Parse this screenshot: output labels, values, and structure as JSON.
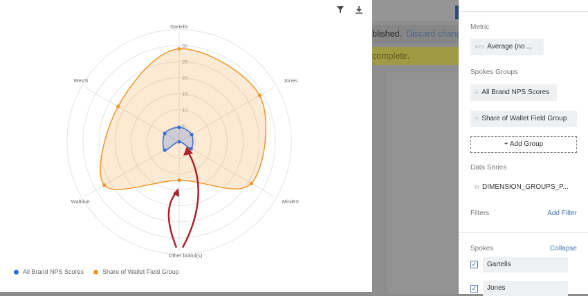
{
  "background": {
    "publish_text": "blished.",
    "discard_link": "Discard changes",
    "warning_text": "complete."
  },
  "toolbar": {
    "filter_icon": "filter-icon",
    "download_icon": "download-icon"
  },
  "chart_data": {
    "type": "radar",
    "axes": [
      "Gartells",
      "Jones",
      "MiniRX",
      "Other brand(s)",
      "Walblue",
      "WeVS"
    ],
    "radial_ticks": [
      "5",
      "10",
      "15",
      "20",
      "25",
      "30"
    ],
    "rmax": 30,
    "series": [
      {
        "name": "All Brand NPS Scores",
        "color": "#3e6fd0",
        "values": [
          4.5,
          4.5,
          4.3,
          0,
          5.2,
          5.2
        ]
      },
      {
        "name": "Share of Wallet Field Group",
        "color": "#f0962a",
        "values": [
          29,
          29,
          26,
          12,
          27,
          22
        ]
      }
    ],
    "legend_position": "bottom-left",
    "annotation": "two red arrows pointing at the Other brand(s) points"
  },
  "sidebar": {
    "metric_label": "Metric",
    "metric_prefix": "AVG",
    "metric_value": "Average (no ...",
    "spokes_groups_label": "Spokes Groups",
    "groups": [
      "All Brand NPS Scores",
      "Share of Wallet Field Group"
    ],
    "add_group": "+ Add Group",
    "data_series_label": "Data Series",
    "data_series_value": "DIMENSION_GROUPS_P...",
    "filters_label": "Filters",
    "add_filter": "Add Filter",
    "spokes_label": "Spokes",
    "collapse": "Collapse",
    "spokes": [
      {
        "label": "Gartells",
        "checked": true
      },
      {
        "label": "Jones",
        "checked": true
      }
    ]
  }
}
